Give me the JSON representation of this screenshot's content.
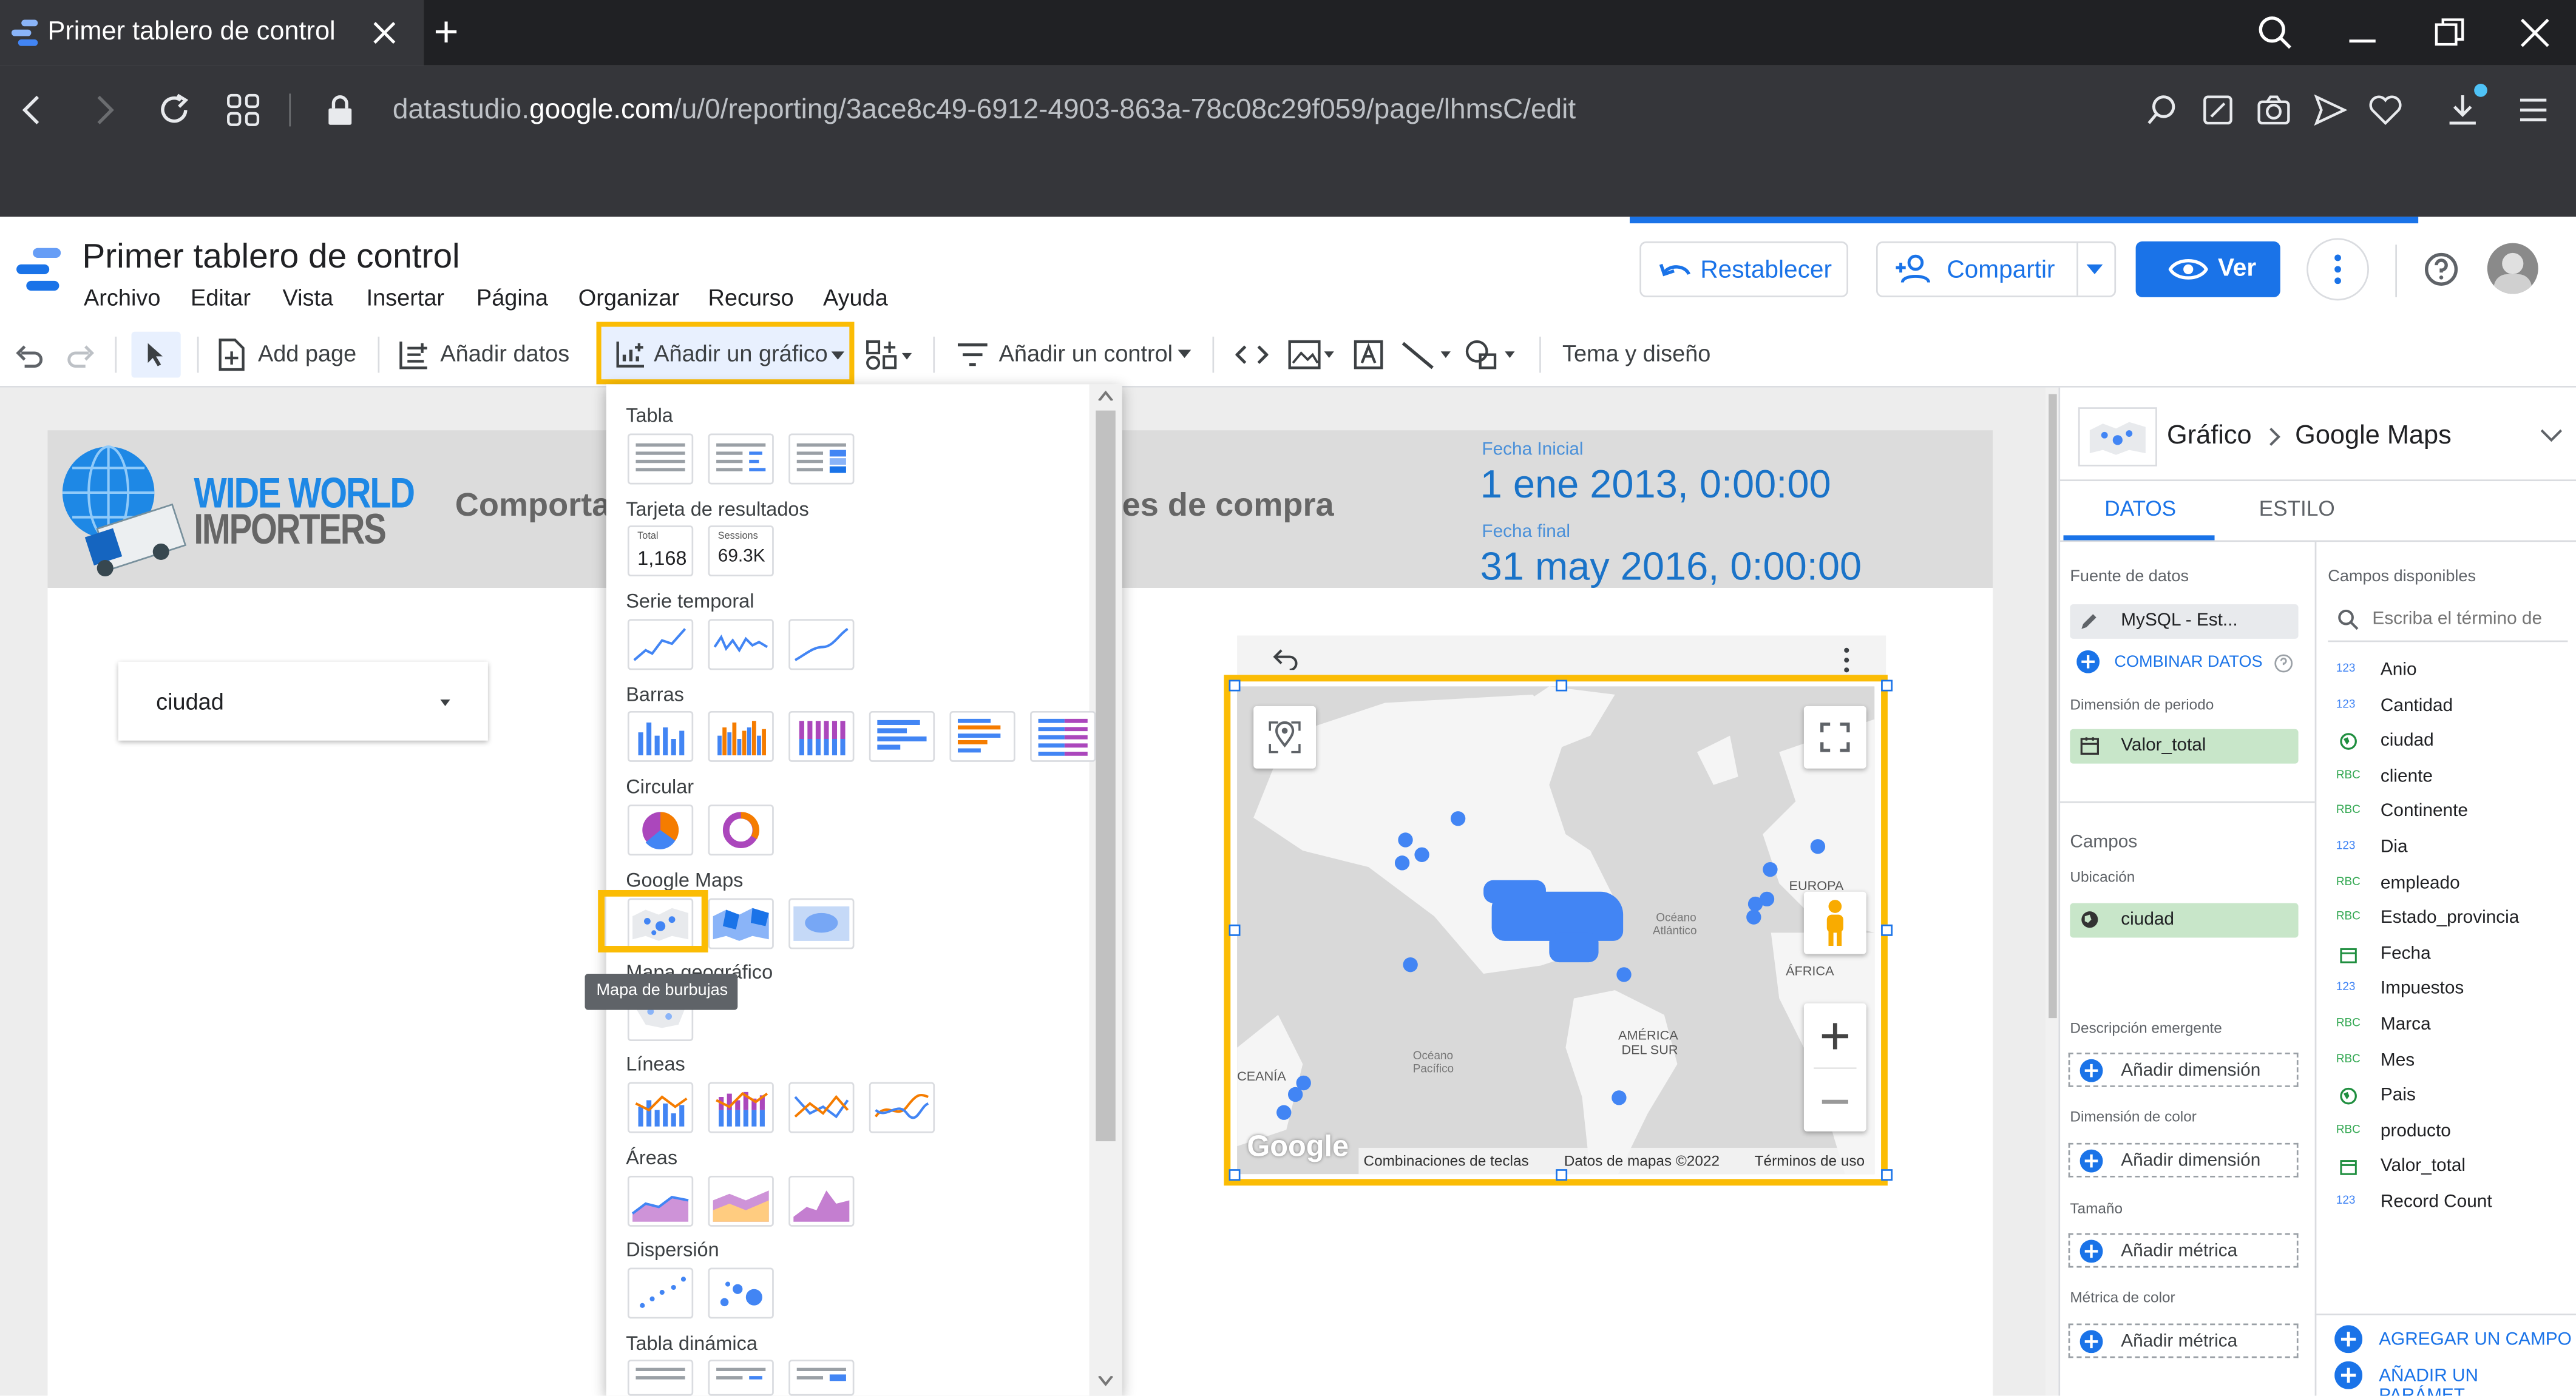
{
  "browser": {
    "tab_title": "Primer tablero de control",
    "new_tab": "+",
    "url_pre": "datastudio.",
    "url_domain": "google.com",
    "url_path": "/u/0/reporting/3ace8c49-6912-4903-863a-78c08c29f059/page/lhmsC/edit"
  },
  "app": {
    "title": "Primer tablero de control",
    "menu": [
      "Archivo",
      "Editar",
      "Vista",
      "Insertar",
      "Página",
      "Organizar",
      "Recurso",
      "Ayuda"
    ],
    "reset_label": "Restablecer",
    "share_label": "Compartir",
    "view_label": "Ver"
  },
  "toolbar": {
    "add_page": "Add page",
    "add_data": "Añadir datos",
    "add_chart": "Añadir un gráfico",
    "add_control": "Añadir un control",
    "theme": "Tema y diseño"
  },
  "report": {
    "logo_line1": "WIDE WORLD",
    "logo_line2": "IMPORTERS",
    "title_left": "Comportar",
    "title_right": "es de compra",
    "start_label": "Fecha Inicial",
    "start_value": "1 ene 2013, 0:00:00",
    "end_label": "Fecha final",
    "end_value": "31 may 2016, 0:00:00",
    "filter_label": "ciudad"
  },
  "map": {
    "labels": {
      "europa": "EUROPA",
      "oceano_atlantico_1": "Océano",
      "oceano_atlantico_2": "Atlántico",
      "africa": "ÁFRICA",
      "america_sur_1": "AMÉRICA",
      "america_sur_2": "DEL SUR",
      "oceano_pacifico_1": "Océano",
      "oceano_pacifico_2": "Pacífico",
      "oceania": "CEANÍA"
    },
    "logo": "Google",
    "footer": [
      "Combinaciones de teclas",
      "Datos de mapas ©2022",
      "Términos de uso"
    ]
  },
  "chart_menu": {
    "sections": [
      {
        "label": "Tabla"
      },
      {
        "label": "Tarjeta de resultados",
        "cards": [
          {
            "caption": "Total",
            "value": "1,168"
          },
          {
            "caption": "Sessions",
            "value": "69.3K"
          }
        ]
      },
      {
        "label": "Serie temporal"
      },
      {
        "label": "Barras"
      },
      {
        "label": "Circular"
      },
      {
        "label": "Google Maps"
      },
      {
        "label": "Mapa geográfico",
        "visible_text": "Mapa geográfico"
      },
      {
        "label": "Líneas"
      },
      {
        "label": "Áreas"
      },
      {
        "label": "Dispersión"
      },
      {
        "label": "Tabla dinámica"
      }
    ],
    "tooltip": "Mapa de burbujas"
  },
  "panel": {
    "breadcrumb_a": "Gráfico",
    "breadcrumb_b": "Google Maps",
    "tab_data": "DATOS",
    "tab_style": "ESTILO",
    "source_label": "Fuente de datos",
    "source_value": "MySQL - Est...",
    "blend_label": "COMBINAR DATOS",
    "period_label": "Dimensión de periodo",
    "period_value": "Valor_total",
    "fields_label": "Campos",
    "location_label": "Ubicación",
    "location_value": "ciudad",
    "tooltip_label": "Descripción emergente",
    "tooltip_add": "Añadir dimensión",
    "color_dim_label": "Dimensión de color",
    "color_dim_add": "Añadir dimensión",
    "size_label": "Tamaño",
    "size_add": "Añadir métrica",
    "color_metric_label": "Métrica de color",
    "color_metric_add": "Añadir métrica"
  },
  "available": {
    "title": "Campos disponibles",
    "search_placeholder": "Escriba el término de",
    "fields": [
      {
        "type": "123",
        "name": "Anio"
      },
      {
        "type": "123",
        "name": "Cantidad"
      },
      {
        "type": "geo",
        "name": "ciudad"
      },
      {
        "type": "RBC",
        "name": "cliente"
      },
      {
        "type": "RBC",
        "name": "Continente"
      },
      {
        "type": "123",
        "name": "Dia"
      },
      {
        "type": "RBC",
        "name": "empleado"
      },
      {
        "type": "RBC",
        "name": "Estado_provincia"
      },
      {
        "type": "date",
        "name": "Fecha"
      },
      {
        "type": "123",
        "name": "Impuestos"
      },
      {
        "type": "RBC",
        "name": "Marca"
      },
      {
        "type": "RBC",
        "name": "Mes"
      },
      {
        "type": "geo",
        "name": "Pais"
      },
      {
        "type": "RBC",
        "name": "producto"
      },
      {
        "type": "date",
        "name": "Valor_total"
      },
      {
        "type": "123",
        "name": "Record Count"
      }
    ],
    "add_field": "AGREGAR UN CAMPO",
    "add_param": "AÑADIR UN PARÁMET..."
  },
  "colors": {
    "accent": "#1a73e8",
    "highlight": "#fbbc04",
    "map_point": "#4285f4"
  }
}
